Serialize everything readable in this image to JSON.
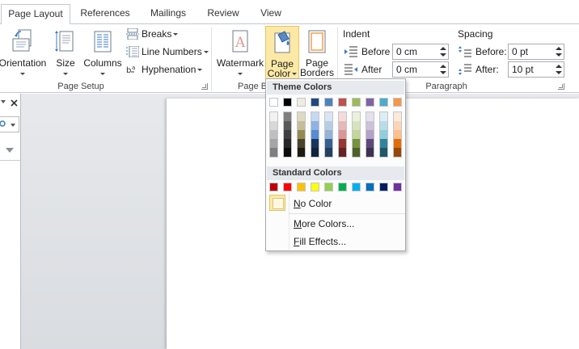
{
  "tabs": [
    {
      "label": "Page Layout",
      "active": true
    },
    {
      "label": "References",
      "active": false
    },
    {
      "label": "Mailings",
      "active": false
    },
    {
      "label": "Review",
      "active": false
    },
    {
      "label": "View",
      "active": false
    }
  ],
  "page_setup": {
    "orientation": "Orientation",
    "size": "Size",
    "columns": "Columns",
    "breaks": "Breaks",
    "line_numbers": "Line Numbers",
    "hyphenation": "Hyphenation",
    "group_label": "Page Setup"
  },
  "page_background": {
    "watermark": "Watermark",
    "page_color_line1": "Page",
    "page_color_line2": "Color",
    "page_borders_line1": "Page",
    "page_borders_line2": "Borders",
    "group_label_partial": "Page B"
  },
  "paragraph": {
    "indent_title": "Indent",
    "spacing_title": "Spacing",
    "before_label": "Before",
    "after_label": "After",
    "indent_before": "0 cm",
    "indent_after": "0 cm",
    "spacing_before_label": "Before:",
    "spacing_after_label": "After:",
    "spacing_before": "0 pt",
    "spacing_after": "10 pt",
    "group_label": "Paragraph"
  },
  "dropdown": {
    "theme_header": "Theme Colors",
    "standard_header": "Standard Colors",
    "no_color": "No Color",
    "more_colors": "More Colors...",
    "fill_effects": "Fill Effects...",
    "theme_base": [
      "#ffffff",
      "#000000",
      "#eeece1",
      "#1f497d",
      "#4f81bd",
      "#c0504d",
      "#9bbb59",
      "#8064a2",
      "#4bacc6",
      "#f79646"
    ],
    "theme_shades": [
      [
        "#f2f2f2",
        "#d8d8d8",
        "#bfbfbf",
        "#a5a5a5",
        "#7f7f7f"
      ],
      [
        "#7f7f7f",
        "#595959",
        "#3f3f3f",
        "#262626",
        "#0c0c0c"
      ],
      [
        "#ddd9c3",
        "#c4bd97",
        "#938953",
        "#494429",
        "#1d1b10"
      ],
      [
        "#c6d9f0",
        "#8db3e2",
        "#548dd4",
        "#17365d",
        "#0f243e"
      ],
      [
        "#dbe5f1",
        "#b8cce4",
        "#95b3d7",
        "#366092",
        "#244061"
      ],
      [
        "#f2dcdb",
        "#e5b9b7",
        "#d99694",
        "#953734",
        "#632423"
      ],
      [
        "#ebf1dd",
        "#d7e3bc",
        "#c3d69b",
        "#76923c",
        "#4f6128"
      ],
      [
        "#e5e0ec",
        "#ccc1d9",
        "#b2a2c7",
        "#5f497a",
        "#3f3151"
      ],
      [
        "#dbeef3",
        "#b7dde8",
        "#92cddc",
        "#31859b",
        "#205867"
      ],
      [
        "#fdeada",
        "#fbd5b5",
        "#fac08f",
        "#e36c09",
        "#974806"
      ]
    ],
    "standard": [
      "#c00000",
      "#ff0000",
      "#ffc000",
      "#ffff00",
      "#92d050",
      "#00b050",
      "#00b0f0",
      "#0070c0",
      "#002060",
      "#7030a0"
    ]
  }
}
